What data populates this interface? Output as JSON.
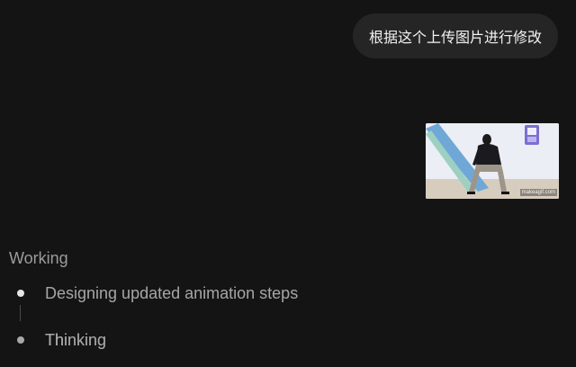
{
  "user_message": {
    "text": "根据这个上传图片进行修改"
  },
  "attachment": {
    "kind": "gif-preview",
    "watermark": "makeagif.com",
    "icon": "dancing-person-image"
  },
  "status": {
    "heading": "Working",
    "steps": [
      {
        "label": "Designing updated animation steps",
        "state": "done"
      },
      {
        "label": "Thinking",
        "state": "in-progress"
      }
    ]
  },
  "colors": {
    "background": "#141414",
    "bubble": "#252525",
    "muted_text": "#9b9b9b"
  }
}
